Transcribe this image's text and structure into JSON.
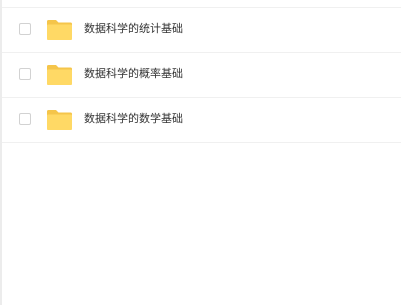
{
  "file_list": {
    "items": [
      {
        "name": "数据科学的统计基础",
        "icon": "folder-icon",
        "checked": false
      },
      {
        "name": "数据科学的概率基础",
        "icon": "folder-icon",
        "checked": false
      },
      {
        "name": "数据科学的数学基础",
        "icon": "folder-icon",
        "checked": false
      }
    ]
  },
  "colors": {
    "folder_back": "#f5c54a",
    "folder_front": "#ffd965",
    "divider": "#f0f0f0",
    "text": "#333333"
  }
}
